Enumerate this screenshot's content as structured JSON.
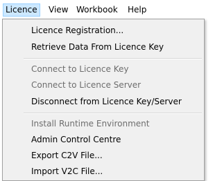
{
  "menubar": {
    "items": [
      {
        "label": "Licence"
      },
      {
        "label": "View"
      },
      {
        "label": "Workbook"
      },
      {
        "label": "Help"
      }
    ]
  },
  "licence_menu": {
    "items": [
      {
        "label": "Licence Registration...",
        "enabled": true
      },
      {
        "label": "Retrieve Data From Licence Key",
        "enabled": true
      },
      {
        "label": "Connect to Licence Key",
        "enabled": false
      },
      {
        "label": "Connect to Licence Server",
        "enabled": false
      },
      {
        "label": "Disconnect from Licence Key/Server",
        "enabled": true
      },
      {
        "label": "Install Runtime Environment",
        "enabled": false
      },
      {
        "label": "Admin Control Centre",
        "enabled": true
      },
      {
        "label": "Export C2V File...",
        "enabled": true
      },
      {
        "label": "Import V2C File...",
        "enabled": true
      }
    ]
  },
  "colors": {
    "menubar_highlight": "#cce8ff",
    "menubar_highlight_border": "#99d1ff",
    "menu_background": "#f0f0f0",
    "disabled_text": "#6d6d6d"
  }
}
